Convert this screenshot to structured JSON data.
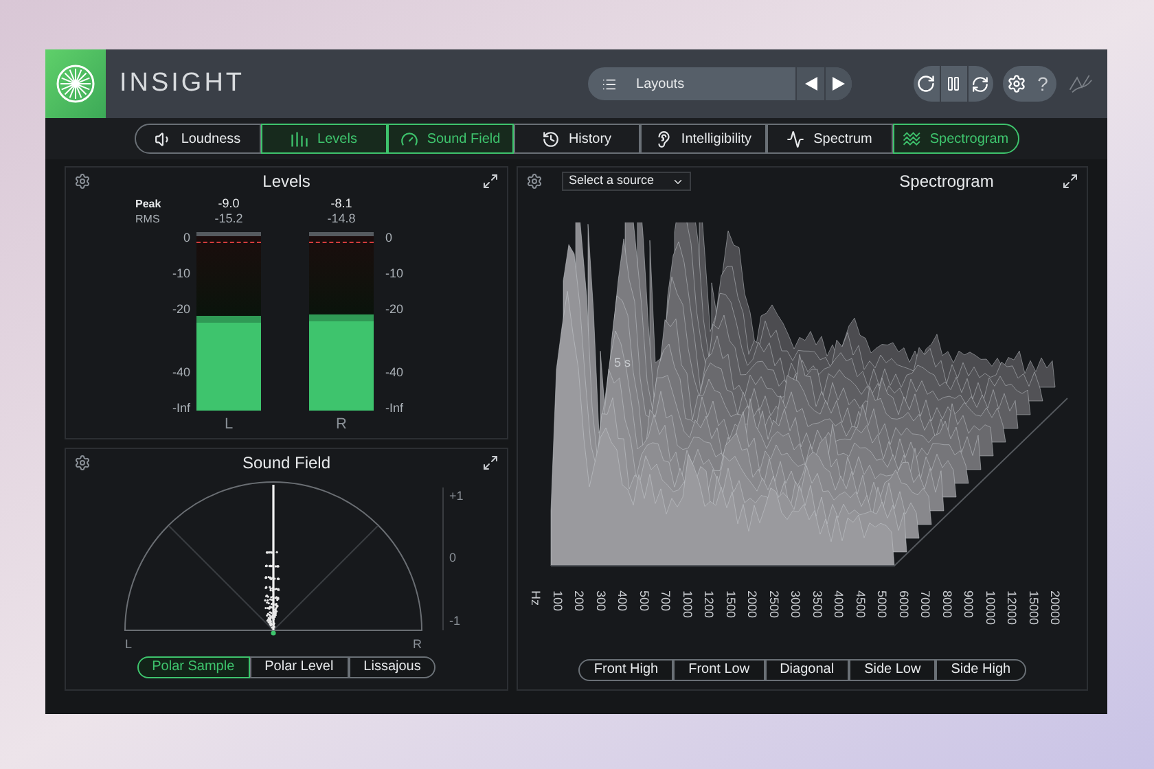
{
  "app": {
    "title": "INSIGHT"
  },
  "layouts": {
    "label": "Layouts"
  },
  "help": "?",
  "tabs": [
    {
      "label": "Loudness",
      "selected": false
    },
    {
      "label": "Levels",
      "selected": true
    },
    {
      "label": "Sound Field",
      "selected": true
    },
    {
      "label": "History",
      "selected": false
    },
    {
      "label": "Intelligibility",
      "selected": false
    },
    {
      "label": "Spectrum",
      "selected": false
    },
    {
      "label": "Spectrogram",
      "selected": true
    }
  ],
  "levels": {
    "title": "Levels",
    "peak_label": "Peak",
    "rms_label": "RMS",
    "channels": [
      {
        "name": "L",
        "peak": "-9.0",
        "rms": "-15.2",
        "level": 0.54,
        "scale": [
          "0",
          "-10",
          "-20",
          "-40",
          "-Inf"
        ]
      },
      {
        "name": "R",
        "peak": "-8.1",
        "rms": "-14.8",
        "level": 0.55,
        "scale": [
          "0",
          "-10",
          "-20",
          "-40",
          "-Inf"
        ]
      }
    ]
  },
  "sound_field": {
    "title": "Sound Field",
    "left": "L",
    "right": "R",
    "scale": [
      "+1",
      "0",
      "-1"
    ],
    "modes": [
      {
        "label": "Polar Sample",
        "selected": true
      },
      {
        "label": "Polar Level",
        "selected": false
      },
      {
        "label": "Lissajous",
        "selected": false
      }
    ]
  },
  "spectrogram": {
    "title": "Spectrogram",
    "source": {
      "value": "Select a source"
    },
    "time_label": "5 s",
    "frequencies": [
      "Hz",
      "100",
      "200",
      "300",
      "400",
      "500",
      "700",
      "1000",
      "1200",
      "1500",
      "2000",
      "2500",
      "3000",
      "3500",
      "4000",
      "4500",
      "5000",
      "6000",
      "7000",
      "8000",
      "9000",
      "10000",
      "12000",
      "15000",
      "20000"
    ],
    "views": [
      {
        "label": "Front High",
        "selected": false
      },
      {
        "label": "Front Low",
        "selected": false
      },
      {
        "label": "Diagonal",
        "selected": false
      },
      {
        "label": "Side Low",
        "selected": false
      },
      {
        "label": "Side High",
        "selected": false
      }
    ]
  }
}
